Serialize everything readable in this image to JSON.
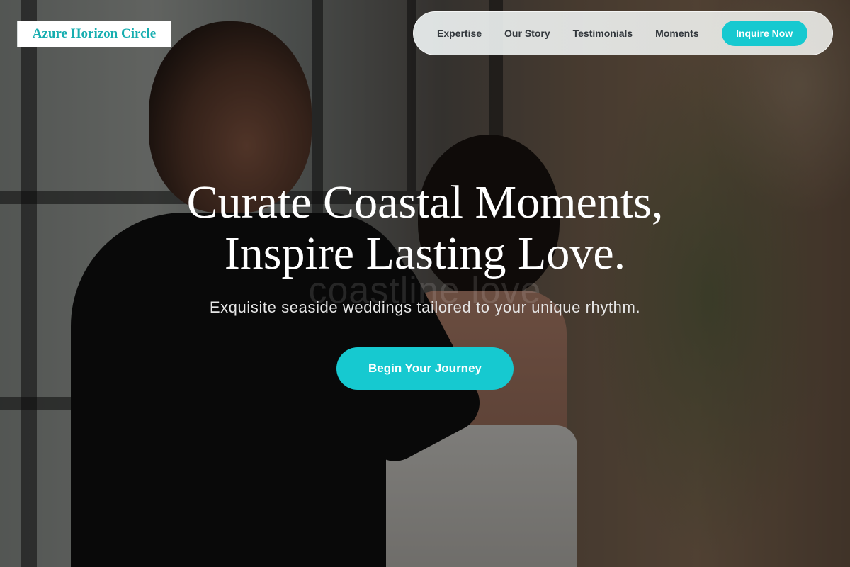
{
  "brand": {
    "name": "Azure Horizon Circle",
    "accent": "#16c9d0"
  },
  "nav": {
    "links": [
      {
        "label": "Expertise"
      },
      {
        "label": "Our Story"
      },
      {
        "label": "Testimonials"
      },
      {
        "label": "Moments"
      }
    ],
    "cta_label": "Inquire Now"
  },
  "hero": {
    "title_line1": "Curate Coastal Moments,",
    "title_line2": "Inspire Lasting Love.",
    "watermark": "coastline love",
    "subtitle": "Exquisite seaside weddings tailored to your unique rhythm.",
    "cta_label": "Begin Your Journey"
  }
}
